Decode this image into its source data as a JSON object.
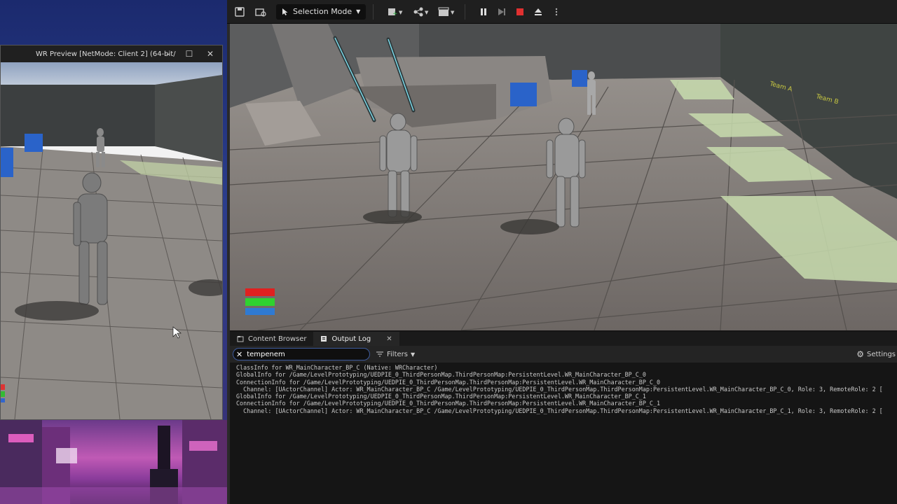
{
  "preview_window": {
    "title": "WR Preview [NetMode: Client 2]  (64-bit/",
    "minimize": "–",
    "maximize": "☐",
    "close": "✕"
  },
  "toolbar": {
    "selection_mode": "Selection Mode",
    "save_icon": "save-icon",
    "content_icon": "browse-icon"
  },
  "viewport": {
    "wall_labels": [
      "Team A",
      "Team B"
    ]
  },
  "tabs": [
    {
      "label": "Content Browser",
      "active": false
    },
    {
      "label": "Output Log",
      "active": true
    }
  ],
  "filterbar": {
    "search_value": "tempenem",
    "filters_label": "Filters",
    "settings_label": "Settings"
  },
  "log_lines": [
    "ClassInfo for WR_MainCharacter_BP_C (Native: WRCharacter)",
    "GlobalInfo for /Game/LevelPrototyping/UEDPIE_0_ThirdPersonMap.ThirdPersonMap:PersistentLevel.WR_MainCharacter_BP_C_0",
    "ConnectionInfo for /Game/LevelPrototyping/UEDPIE_0_ThirdPersonMap.ThirdPersonMap:PersistentLevel.WR_MainCharacter_BP_C_0",
    "  Channel: [UActorChannel] Actor: WR_MainCharacter_BP_C /Game/LevelPrototyping/UEDPIE_0_ThirdPersonMap.ThirdPersonMap:PersistentLevel.WR_MainCharacter_BP_C_0, Role: 3, RemoteRole: 2 [",
    "GlobalInfo for /Game/LevelPrototyping/UEDPIE_0_ThirdPersonMap.ThirdPersonMap:PersistentLevel.WR_MainCharacter_BP_C_1",
    "ConnectionInfo for /Game/LevelPrototyping/UEDPIE_0_ThirdPersonMap.ThirdPersonMap:PersistentLevel.WR_MainCharacter_BP_C_1",
    "  Channel: [UActorChannel] Actor: WR_MainCharacter_BP_C /Game/LevelPrototyping/UEDPIE_0_ThirdPersonMap.ThirdPersonMap:PersistentLevel.WR_MainCharacter_BP_C_1, Role: 3, RemoteRole: 2 ["
  ],
  "colors": {
    "accent": "#3d5a9c",
    "stop_red": "#e03030",
    "play_green": "#3bb04b"
  }
}
